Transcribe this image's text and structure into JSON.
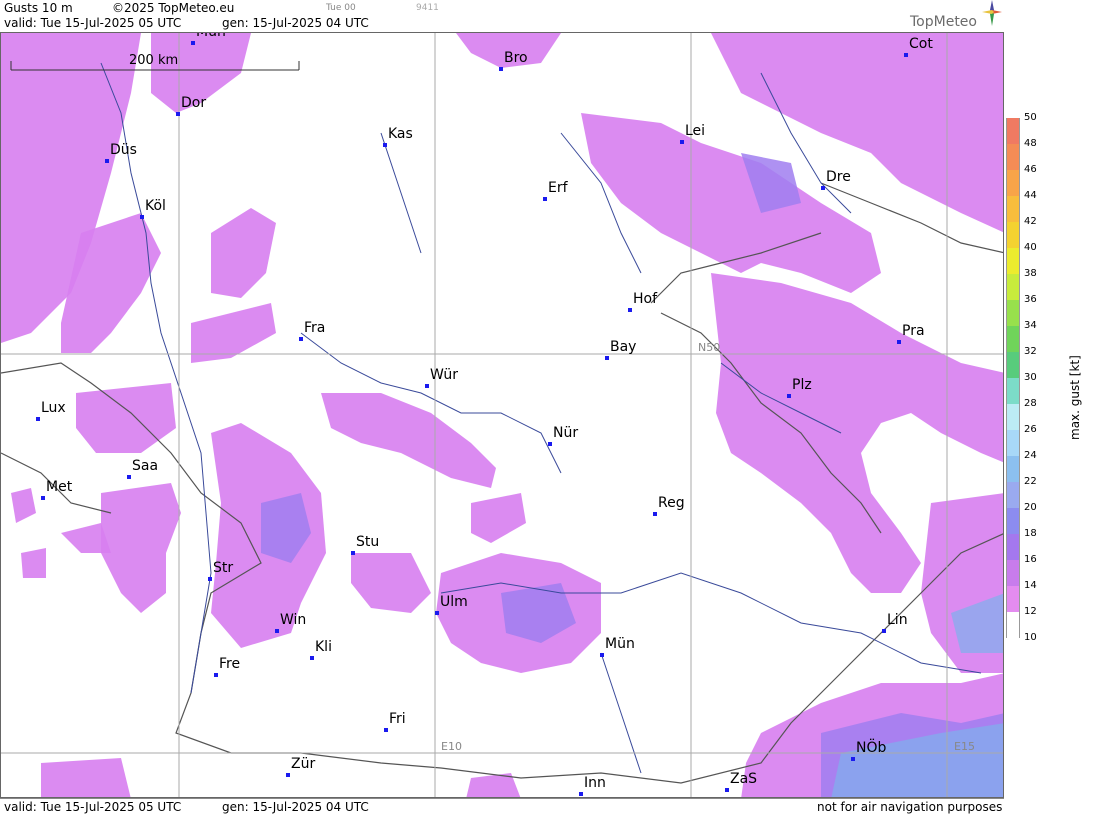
{
  "header": {
    "product": "Gusts 10 m",
    "copyright": "©2025 TopMeteo.eu",
    "run": "Tue 00",
    "code": "9411",
    "valid": "valid:  Tue  15-Jul-2025  05 UTC",
    "gen": "gen: 15-Jul-2025 04 UTC",
    "brand": "TopMeteo"
  },
  "footer": {
    "valid": "valid:  Tue  15-Jul-2025  05 UTC",
    "gen": "gen: 15-Jul-2025 04 UTC",
    "note": "not for air navigation purposes"
  },
  "scale_bar": "200 km",
  "grid_labels": {
    "lat": "N50",
    "lon1": "E10",
    "lon2": "E15"
  },
  "cities": [
    {
      "name": "Mün",
      "id": "mun-north"
    },
    {
      "name": "Bro",
      "id": "bro"
    },
    {
      "name": "Cot",
      "id": "cot"
    },
    {
      "name": "Dor",
      "id": "dor"
    },
    {
      "name": "Kas",
      "id": "kas"
    },
    {
      "name": "Lei",
      "id": "lei"
    },
    {
      "name": "Düs",
      "id": "dus"
    },
    {
      "name": "Erf",
      "id": "erf"
    },
    {
      "name": "Dre",
      "id": "dre"
    },
    {
      "name": "Köl",
      "id": "kol"
    },
    {
      "name": "Hof",
      "id": "hof"
    },
    {
      "name": "Fra",
      "id": "fra"
    },
    {
      "name": "Pra",
      "id": "pra"
    },
    {
      "name": "Bay",
      "id": "bay"
    },
    {
      "name": "Wür",
      "id": "wur"
    },
    {
      "name": "Plz",
      "id": "plz"
    },
    {
      "name": "Lux",
      "id": "lux"
    },
    {
      "name": "Nür",
      "id": "nur"
    },
    {
      "name": "Saa",
      "id": "saa"
    },
    {
      "name": "Met",
      "id": "met"
    },
    {
      "name": "Reg",
      "id": "reg"
    },
    {
      "name": "Stu",
      "id": "stu"
    },
    {
      "name": "Str",
      "id": "str"
    },
    {
      "name": "Ulm",
      "id": "ulm"
    },
    {
      "name": "Win",
      "id": "win"
    },
    {
      "name": "Lin",
      "id": "lin"
    },
    {
      "name": "Mün",
      "id": "mun"
    },
    {
      "name": "Kli",
      "id": "kli"
    },
    {
      "name": "Fre",
      "id": "fre"
    },
    {
      "name": "Fri",
      "id": "fri"
    },
    {
      "name": "NÖb",
      "id": "nob"
    },
    {
      "name": "Zür",
      "id": "zur"
    },
    {
      "name": "ZaS",
      "id": "zas"
    },
    {
      "name": "Inn",
      "id": "inn"
    }
  ],
  "legend": {
    "title": "max. gust [kt]",
    "ticks": [
      "50",
      "48",
      "46",
      "44",
      "42",
      "40",
      "38",
      "36",
      "34",
      "32",
      "30",
      "28",
      "26",
      "24",
      "22",
      "20",
      "18",
      "16",
      "14",
      "12",
      "10"
    ],
    "colors": [
      "#f07a62",
      "#f48c56",
      "#f8a448",
      "#f8bd3c",
      "#f4d230",
      "#ecec2e",
      "#c8ec3c",
      "#98e04c",
      "#70d45a",
      "#58cc7c",
      "#7cdcc8",
      "#bcecf4",
      "#a8d8f8",
      "#8cc0f0",
      "#9aaaf0",
      "#8c8cf0",
      "#a478ee",
      "#c87cec",
      "#e48cf0",
      "#ffffff"
    ]
  }
}
